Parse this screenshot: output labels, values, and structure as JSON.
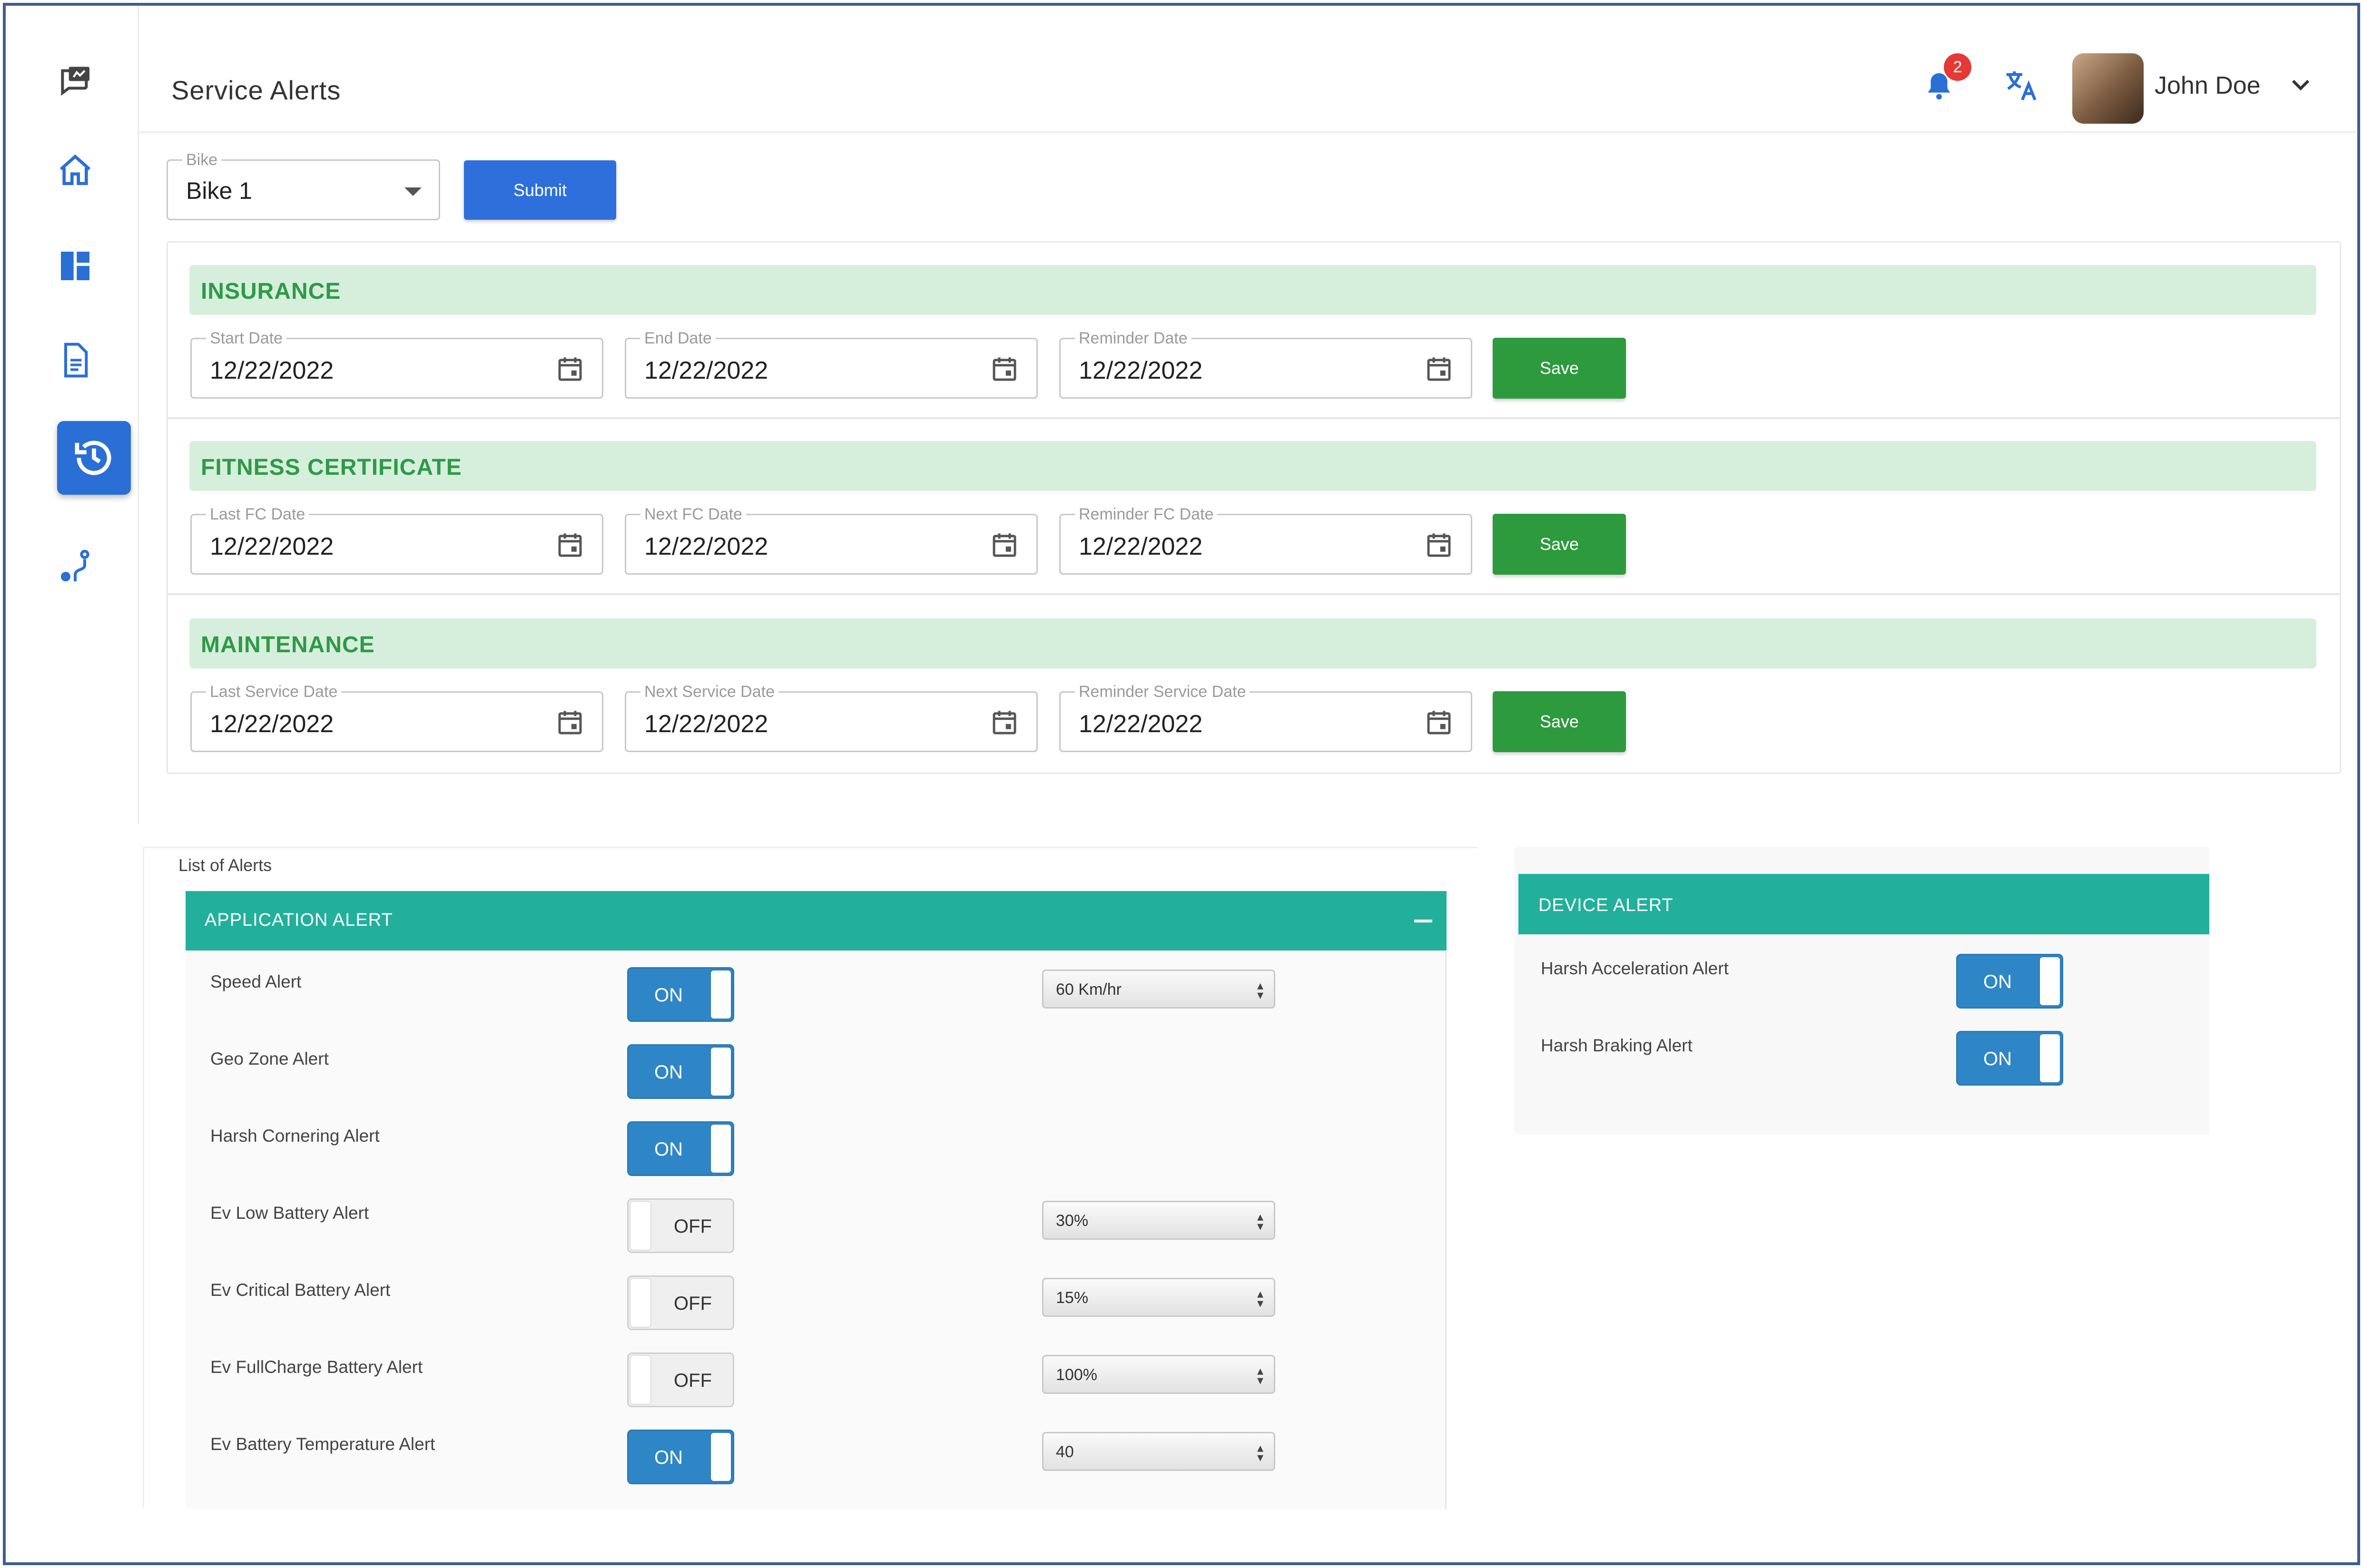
{
  "header": {
    "title": "Service Alerts",
    "notification_count": "2",
    "user_name": "John Doe"
  },
  "sidebar": {
    "items": [
      {
        "icon": "chat-icon"
      },
      {
        "icon": "home-icon"
      },
      {
        "icon": "dashboard-icon"
      },
      {
        "icon": "document-icon"
      },
      {
        "icon": "history-icon",
        "active": true
      },
      {
        "icon": "route-icon"
      }
    ]
  },
  "bike_select": {
    "label": "Bike",
    "value": "Bike 1"
  },
  "submit_label": "Submit",
  "sections": [
    {
      "title": "INSURANCE",
      "fields": [
        {
          "label": "Start Date",
          "value": "12/22/2022"
        },
        {
          "label": "End Date",
          "value": "12/22/2022"
        },
        {
          "label": "Reminder Date",
          "value": "12/22/2022"
        }
      ],
      "save_label": "Save"
    },
    {
      "title": "FITNESS CERTIFICATE",
      "fields": [
        {
          "label": "Last FC Date",
          "value": "12/22/2022"
        },
        {
          "label": "Next FC Date",
          "value": "12/22/2022"
        },
        {
          "label": "Reminder FC Date",
          "value": "12/22/2022"
        }
      ],
      "save_label": "Save"
    },
    {
      "title": "MAINTENANCE",
      "fields": [
        {
          "label": "Last Service Date",
          "value": "12/22/2022"
        },
        {
          "label": "Next Service Date",
          "value": "12/22/2022"
        },
        {
          "label": "Reminder Service Date",
          "value": "12/22/2022"
        }
      ],
      "save_label": "Save"
    }
  ],
  "alerts": {
    "caption": "List of Alerts",
    "application": {
      "title": "APPLICATION ALERT",
      "rows": [
        {
          "label": "Speed Alert",
          "toggle": "ON",
          "select": "60 Km/hr"
        },
        {
          "label": "Geo Zone Alert",
          "toggle": "ON",
          "select": null
        },
        {
          "label": "Harsh Cornering Alert",
          "toggle": "ON",
          "select": null
        },
        {
          "label": "Ev Low Battery Alert",
          "toggle": "OFF",
          "select": "30%"
        },
        {
          "label": "Ev Critical Battery Alert",
          "toggle": "OFF",
          "select": "15%"
        },
        {
          "label": "Ev FullCharge Battery Alert",
          "toggle": "OFF",
          "select": "100%"
        },
        {
          "label": "Ev Battery Temperature Alert",
          "toggle": "ON",
          "select": "40"
        }
      ]
    },
    "device": {
      "title": "DEVICE ALERT",
      "rows": [
        {
          "label": "Harsh Acceleration Alert",
          "toggle": "ON"
        },
        {
          "label": "Harsh Braking Alert",
          "toggle": "ON"
        }
      ]
    }
  },
  "colors": {
    "primary_blue": "#2f6fdc",
    "save_green": "#2e9a3e",
    "section_bg": "#d6efdc",
    "section_text": "#2e9a46",
    "teal_header": "#22b09c",
    "toggle_on": "#2f86c6",
    "badge_red": "#e53935"
  }
}
